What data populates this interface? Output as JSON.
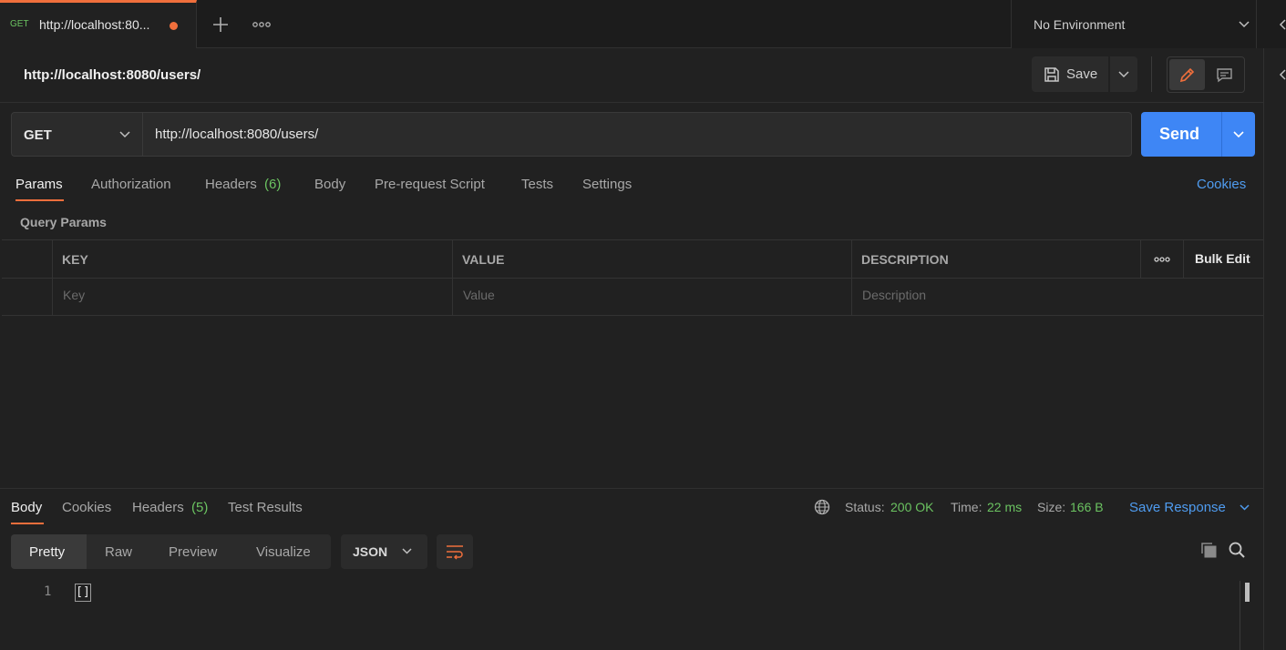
{
  "tabs": [
    {
      "method": "GET",
      "title": "http://localhost:80...",
      "unsaved": true
    }
  ],
  "environment": {
    "selected": "No Environment"
  },
  "request": {
    "name": "http://localhost:8080/users/",
    "method": "GET",
    "url": "http://localhost:8080/users/"
  },
  "toolbar": {
    "save_label": "Save",
    "send_label": "Send"
  },
  "request_tabs": {
    "params": "Params",
    "authorization": "Authorization",
    "headers": "Headers",
    "headers_count": "(6)",
    "body": "Body",
    "pre_request": "Pre-request Script",
    "tests": "Tests",
    "settings": "Settings",
    "cookies": "Cookies",
    "active": "Params"
  },
  "query_params": {
    "title": "Query Params",
    "columns": {
      "key": "KEY",
      "value": "VALUE",
      "description": "DESCRIPTION"
    },
    "bulk_edit": "Bulk Edit",
    "placeholders": {
      "key": "Key",
      "value": "Value",
      "description": "Description"
    }
  },
  "response_tabs": {
    "body": "Body",
    "cookies": "Cookies",
    "headers": "Headers",
    "headers_count": "(5)",
    "test_results": "Test Results",
    "active": "Body"
  },
  "response_status": {
    "status_label": "Status:",
    "status_value": "200 OK",
    "time_label": "Time:",
    "time_value": "22 ms",
    "size_label": "Size:",
    "size_value": "166 B",
    "save_response": "Save Response"
  },
  "response_view": {
    "modes": [
      "Pretty",
      "Raw",
      "Preview",
      "Visualize"
    ],
    "active_mode": "Pretty",
    "format": "JSON",
    "line_number": "1",
    "content": "[]"
  },
  "colors": {
    "accent": "#f06f3c",
    "send_button": "#3e86f5",
    "link": "#4f9cf0",
    "success": "#6bc361",
    "background": "#212121"
  },
  "icons": [
    "plus-icon",
    "more-icon",
    "chevron-down-icon",
    "save-icon",
    "pencil-icon",
    "comment-icon",
    "globe-icon",
    "wrap-icon",
    "copy-icon",
    "search-icon"
  ]
}
